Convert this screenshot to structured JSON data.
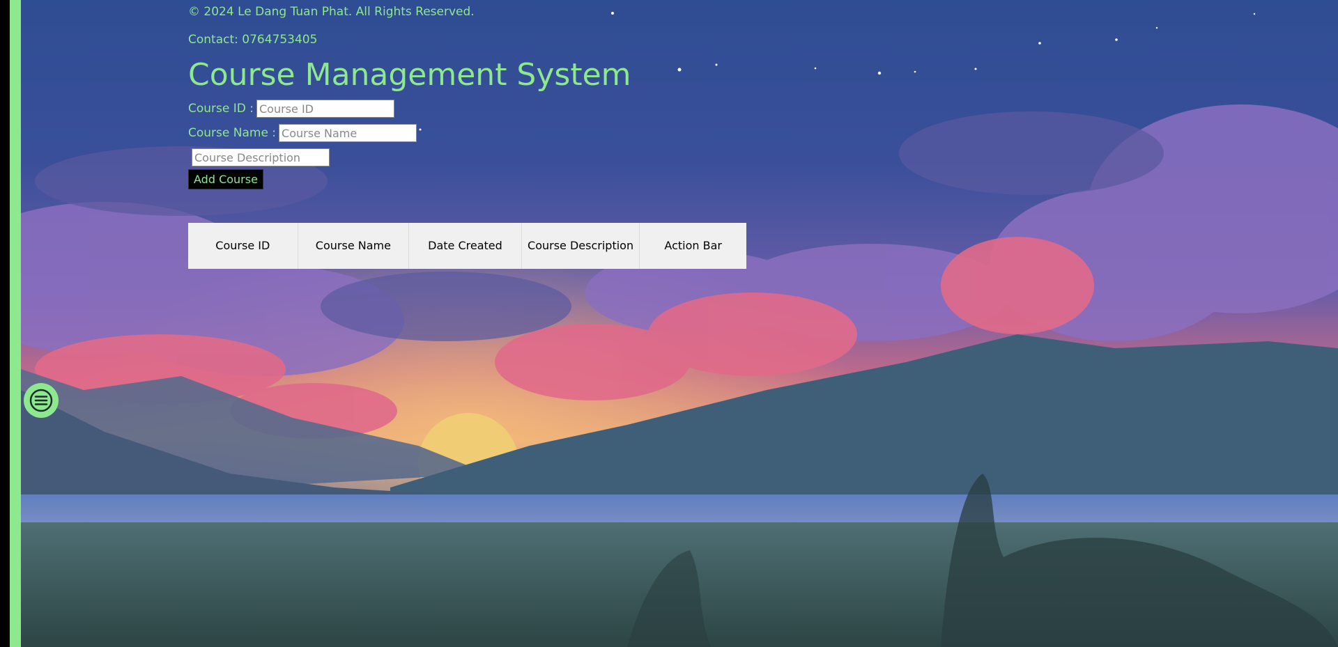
{
  "footer": {
    "copyright": "© 2024 Le Dang Tuan Phat. All Rights Reserved.",
    "contact": "Contact: 0764753405"
  },
  "page": {
    "title": "Course Management System"
  },
  "form": {
    "course_id_label": "Course ID :",
    "course_id_placeholder": "Course ID",
    "course_name_label": "Course Name :",
    "course_name_placeholder": "Course Name",
    "course_description_placeholder": "Course Description",
    "add_button": "Add Course"
  },
  "table": {
    "headers": [
      "Course ID",
      "Course Name",
      "Date Created",
      "Course Description",
      "Action Bar"
    ]
  },
  "menu": {
    "icon": "hamburger-menu-icon"
  },
  "colors": {
    "accent": "#8ee88e",
    "sidebar_dark": "#000000",
    "table_bg": "#f0f0f0"
  }
}
